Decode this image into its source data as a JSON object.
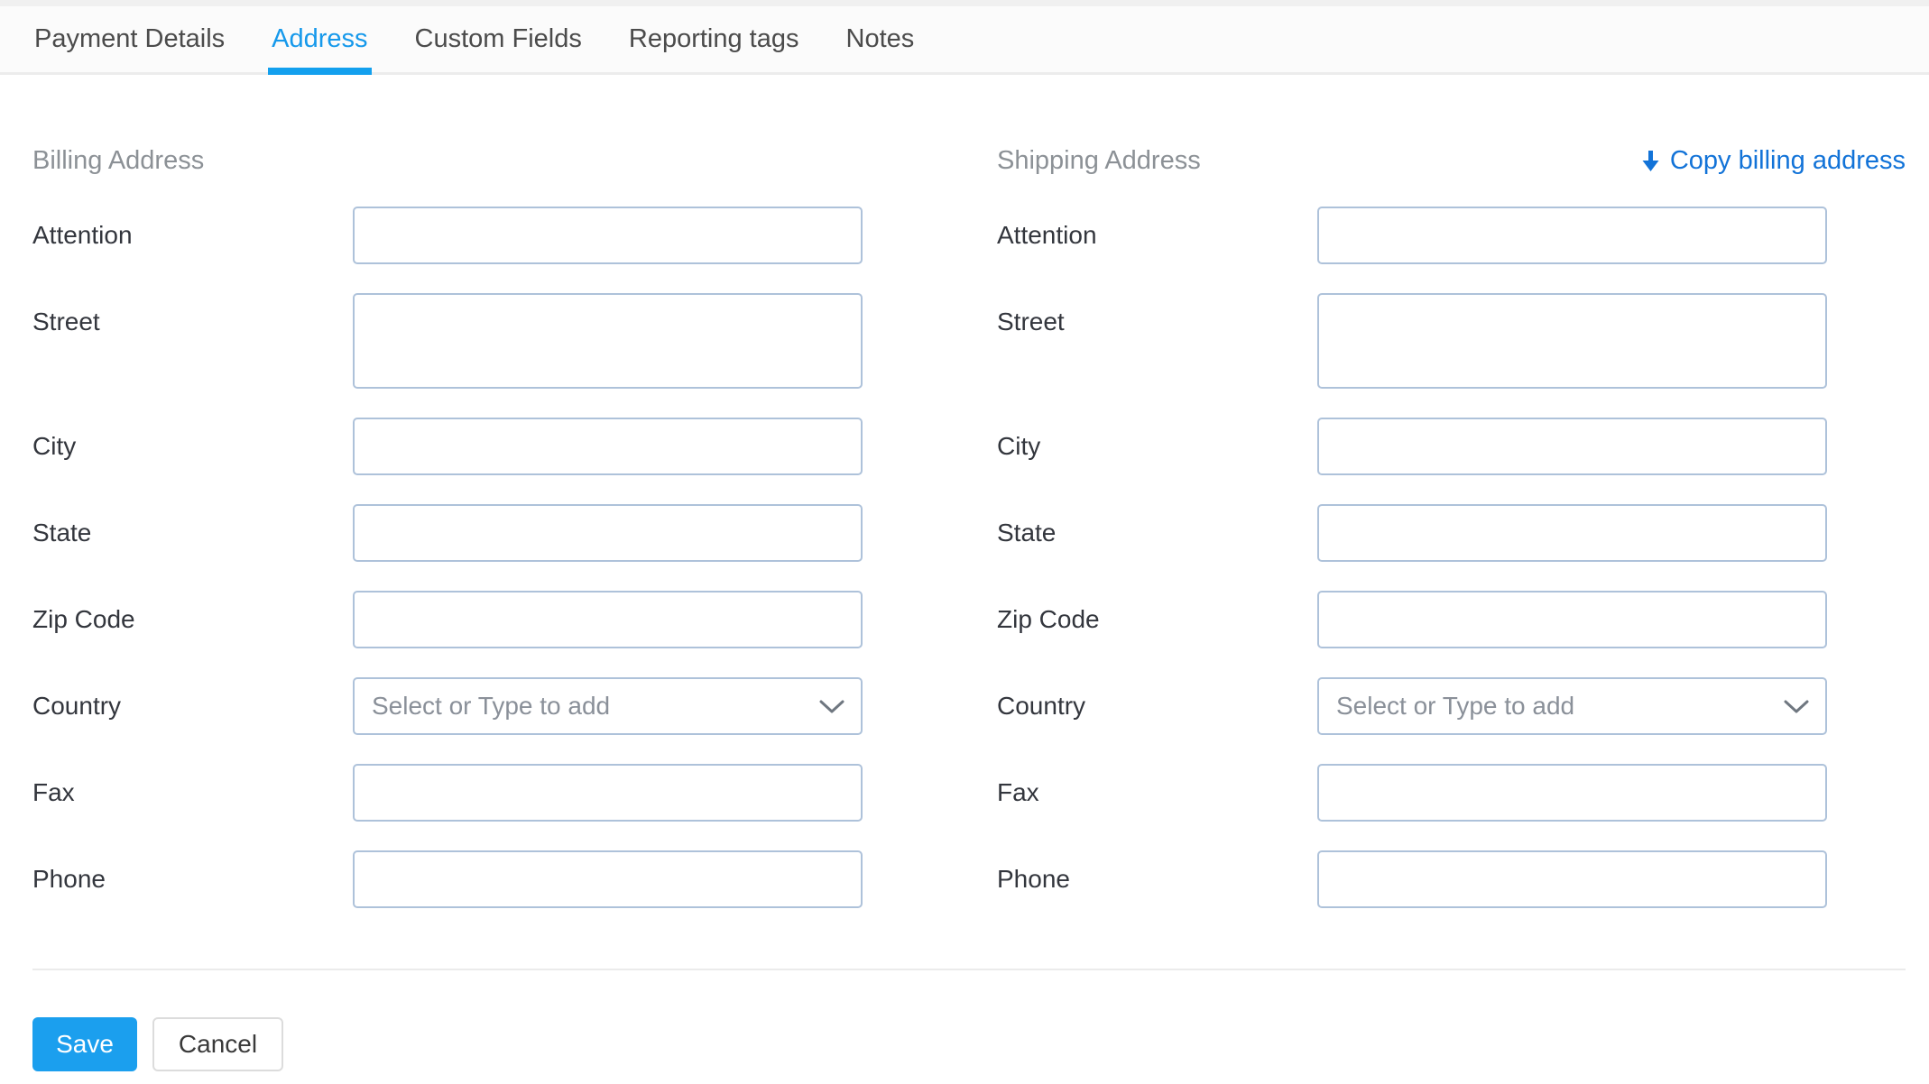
{
  "tabs": {
    "items": [
      {
        "label": "Payment Details",
        "active": false
      },
      {
        "label": "Address",
        "active": true
      },
      {
        "label": "Custom Fields",
        "active": false
      },
      {
        "label": "Reporting tags",
        "active": false
      },
      {
        "label": "Notes",
        "active": false
      }
    ]
  },
  "copy_link": {
    "label": "Copy billing address",
    "icon": "arrow-down-icon"
  },
  "billing": {
    "heading": "Billing Address",
    "fields": {
      "attention": {
        "label": "Attention",
        "value": ""
      },
      "street": {
        "label": "Street",
        "value": ""
      },
      "city": {
        "label": "City",
        "value": ""
      },
      "state": {
        "label": "State",
        "value": ""
      },
      "zip": {
        "label": "Zip Code",
        "value": ""
      },
      "country": {
        "label": "Country",
        "placeholder": "Select or Type to add",
        "selected": ""
      },
      "fax": {
        "label": "Fax",
        "value": ""
      },
      "phone": {
        "label": "Phone",
        "value": ""
      }
    }
  },
  "shipping": {
    "heading": "Shipping Address",
    "fields": {
      "attention": {
        "label": "Attention",
        "value": ""
      },
      "street": {
        "label": "Street",
        "value": ""
      },
      "city": {
        "label": "City",
        "value": ""
      },
      "state": {
        "label": "State",
        "value": ""
      },
      "zip": {
        "label": "Zip Code",
        "value": ""
      },
      "country": {
        "label": "Country",
        "placeholder": "Select or Type to add",
        "selected": ""
      },
      "fax": {
        "label": "Fax",
        "value": ""
      },
      "phone": {
        "label": "Phone",
        "value": ""
      }
    }
  },
  "actions": {
    "save": "Save",
    "cancel": "Cancel"
  },
  "colors": {
    "tab_active_blue": "#1699eb",
    "tab_underline_blue": "#13a0ee",
    "link_blue": "#1273d8",
    "save_blue": "#1b9fee",
    "input_border": "#aec2da",
    "heading_gray": "#8c9196",
    "label_dark": "#33363d"
  }
}
